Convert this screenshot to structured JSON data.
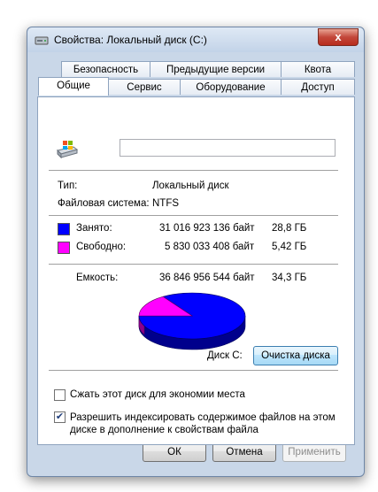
{
  "window": {
    "title": "Свойства: Локальный диск (C:)",
    "close_label": "x"
  },
  "tabs": {
    "row1": [
      "Безопасность",
      "Предыдущие версии",
      "Квота"
    ],
    "row2": [
      "Общие",
      "Сервис",
      "Оборудование",
      "Доступ"
    ]
  },
  "general": {
    "name_value": "",
    "type_label": "Тип:",
    "type_value": "Локальный диск",
    "fs_label": "Файловая система:",
    "fs_value": "NTFS",
    "used_label": "Занято:",
    "used_bytes": "31 016 923 136 байт",
    "used_size": "28,8 ГБ",
    "free_label": "Свободно:",
    "free_bytes": "5 830 033 408 байт",
    "free_size": "5,42 ГБ",
    "capacity_label": "Емкость:",
    "capacity_bytes": "36 846 956 544 байт",
    "capacity_size": "34,3 ГБ",
    "disk_label": "Диск C:",
    "cleanup_button": "Очистка диска",
    "compress_label": "Сжать этот диск для экономии места",
    "compress_checked": false,
    "index_label": "Разрешить индексировать содержимое файлов на этом диске в дополнение к свойствам файла",
    "index_checked": true,
    "used_fraction": 0.842,
    "used_color": "#0000ff",
    "free_color": "#ff00ff"
  },
  "buttons": {
    "ok": "ОК",
    "cancel": "Отмена",
    "apply": "Применить"
  },
  "annotation": {
    "arrow_color": "#e8402a"
  }
}
